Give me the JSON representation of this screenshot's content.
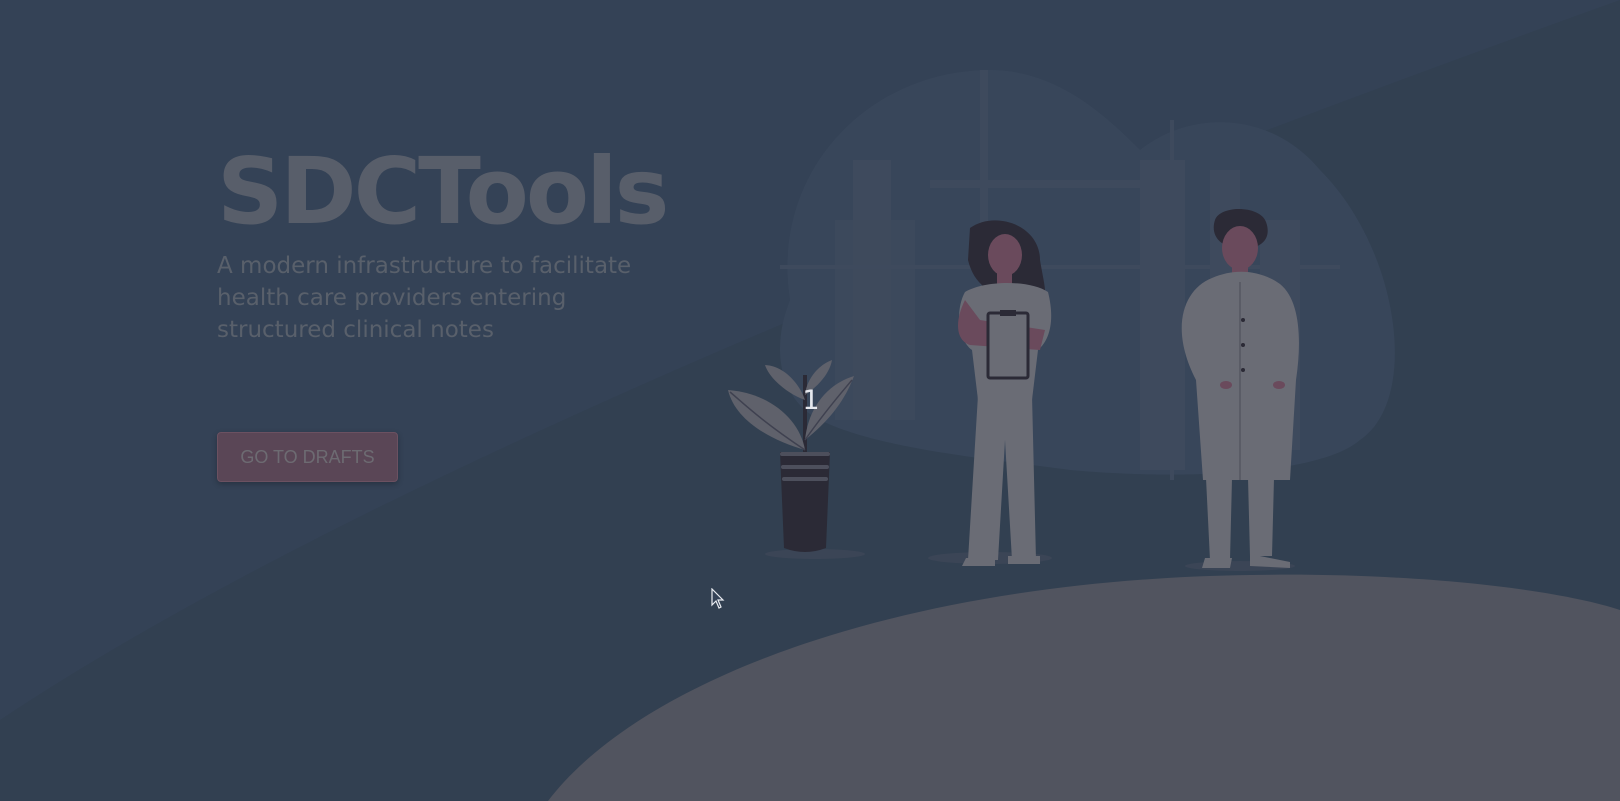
{
  "hero": {
    "title": "SDCTools",
    "subtitle": "A modern infrastructure to facilitate health care providers entering structured clinical notes",
    "cta_label": "GO TO DRAFTS"
  },
  "overlay": {
    "step_number": "1"
  },
  "illustration": {
    "name": "medical-staff-illustration",
    "figures": [
      "nurse",
      "doctor",
      "potted-plant",
      "hospital-building"
    ]
  },
  "colors": {
    "background": "#344256",
    "ground_shape": "#51545f",
    "figure_light": "#6a6c75",
    "figure_dark": "#2b2a36",
    "skin": "#6a4a5c",
    "button": "#5a4656",
    "text_muted": "#585e6a"
  }
}
